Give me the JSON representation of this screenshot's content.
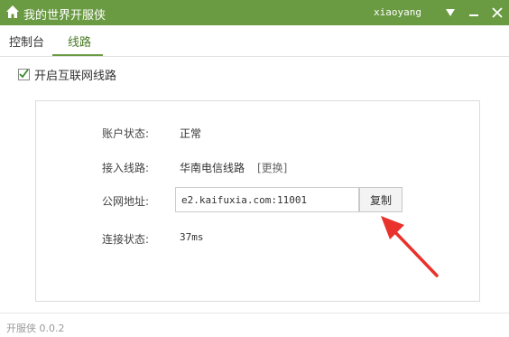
{
  "window": {
    "title": "我的世界开服侠",
    "username": "xiaoyang",
    "accent_color": "#6a9a42"
  },
  "icons": {
    "home": "home-icon",
    "dropdown": "triangle-down-icon",
    "minimize": "minimize-icon",
    "close": "close-icon",
    "check": "check-icon",
    "arrow": "red-arrow-icon"
  },
  "tabs": [
    {
      "label": "控制台",
      "active": false
    },
    {
      "label": "线路",
      "active": true
    }
  ],
  "enable_internet_route": {
    "label": "开启互联网线路",
    "checked": true
  },
  "panel": {
    "account_status_label": "账户状态:",
    "account_status_value": "正常",
    "route_label": "接入线路:",
    "route_value": "华南电信线路",
    "change_link": "[更换]",
    "public_address_label": "公网地址:",
    "public_address_value": "e2.kaifuxia.com:11001",
    "copy_button": "复制",
    "connection_status_label": "连接状态:",
    "connection_status_value": "37ms"
  },
  "annotation_color": "#e8322b",
  "footer": {
    "version": "开服侠 0.0.2"
  }
}
